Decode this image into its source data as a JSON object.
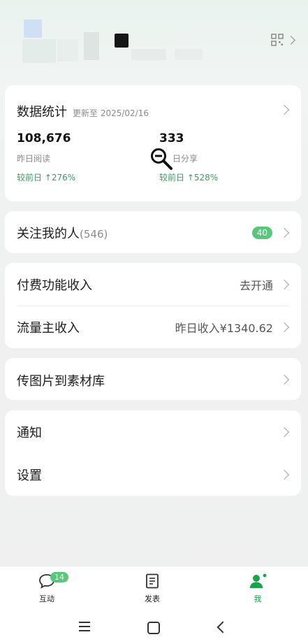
{
  "stats_card": {
    "title": "数据统计",
    "updated": "更新至 2025/02/16",
    "left": {
      "value": "108,676",
      "label": "昨日阅读",
      "change": "较前日 ↑276%"
    },
    "right": {
      "value": "333",
      "label": "日分享",
      "change": "较前日 ↑528%"
    }
  },
  "followers": {
    "label": "关注我的人",
    "count": "(546)",
    "badge": "40"
  },
  "income_card": {
    "paid": {
      "label": "付费功能收入",
      "action": "去开通"
    },
    "traffic": {
      "label": "流量主收入",
      "value": "昨日收入¥1340.62"
    }
  },
  "upload": {
    "label": "传图片到素材库"
  },
  "settings_card": {
    "notify": {
      "label": "通知"
    },
    "settings": {
      "label": "设置"
    }
  },
  "tabbar": {
    "tabs": [
      {
        "label": "互动",
        "badge": "14",
        "icon": "chat-bubble-icon",
        "active": false
      },
      {
        "label": "发表",
        "icon": "document-icon",
        "active": false
      },
      {
        "label": "我",
        "icon": "person-icon",
        "active": true
      }
    ]
  },
  "colors": {
    "accent": "#3d9c63",
    "badge": "#58c77b",
    "active_tab": "#1aa34a"
  }
}
